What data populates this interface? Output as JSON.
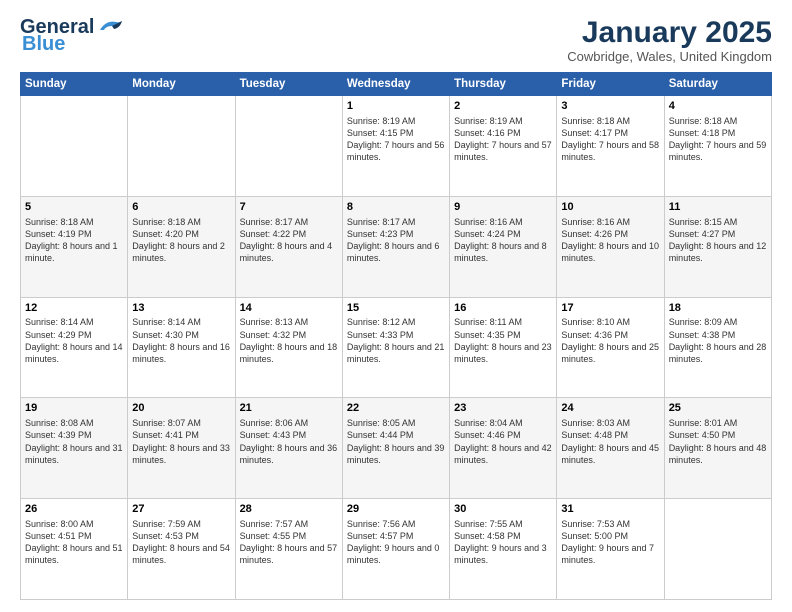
{
  "app": {
    "logo_line1": "General",
    "logo_line2": "Blue"
  },
  "header": {
    "month": "January 2025",
    "location": "Cowbridge, Wales, United Kingdom"
  },
  "weekdays": [
    "Sunday",
    "Monday",
    "Tuesday",
    "Wednesday",
    "Thursday",
    "Friday",
    "Saturday"
  ],
  "weeks": [
    [
      {
        "day": "",
        "sunrise": "",
        "sunset": "",
        "daylight": ""
      },
      {
        "day": "",
        "sunrise": "",
        "sunset": "",
        "daylight": ""
      },
      {
        "day": "",
        "sunrise": "",
        "sunset": "",
        "daylight": ""
      },
      {
        "day": "1",
        "sunrise": "Sunrise: 8:19 AM",
        "sunset": "Sunset: 4:15 PM",
        "daylight": "Daylight: 7 hours and 56 minutes."
      },
      {
        "day": "2",
        "sunrise": "Sunrise: 8:19 AM",
        "sunset": "Sunset: 4:16 PM",
        "daylight": "Daylight: 7 hours and 57 minutes."
      },
      {
        "day": "3",
        "sunrise": "Sunrise: 8:18 AM",
        "sunset": "Sunset: 4:17 PM",
        "daylight": "Daylight: 7 hours and 58 minutes."
      },
      {
        "day": "4",
        "sunrise": "Sunrise: 8:18 AM",
        "sunset": "Sunset: 4:18 PM",
        "daylight": "Daylight: 7 hours and 59 minutes."
      }
    ],
    [
      {
        "day": "5",
        "sunrise": "Sunrise: 8:18 AM",
        "sunset": "Sunset: 4:19 PM",
        "daylight": "Daylight: 8 hours and 1 minute."
      },
      {
        "day": "6",
        "sunrise": "Sunrise: 8:18 AM",
        "sunset": "Sunset: 4:20 PM",
        "daylight": "Daylight: 8 hours and 2 minutes."
      },
      {
        "day": "7",
        "sunrise": "Sunrise: 8:17 AM",
        "sunset": "Sunset: 4:22 PM",
        "daylight": "Daylight: 8 hours and 4 minutes."
      },
      {
        "day": "8",
        "sunrise": "Sunrise: 8:17 AM",
        "sunset": "Sunset: 4:23 PM",
        "daylight": "Daylight: 8 hours and 6 minutes."
      },
      {
        "day": "9",
        "sunrise": "Sunrise: 8:16 AM",
        "sunset": "Sunset: 4:24 PM",
        "daylight": "Daylight: 8 hours and 8 minutes."
      },
      {
        "day": "10",
        "sunrise": "Sunrise: 8:16 AM",
        "sunset": "Sunset: 4:26 PM",
        "daylight": "Daylight: 8 hours and 10 minutes."
      },
      {
        "day": "11",
        "sunrise": "Sunrise: 8:15 AM",
        "sunset": "Sunset: 4:27 PM",
        "daylight": "Daylight: 8 hours and 12 minutes."
      }
    ],
    [
      {
        "day": "12",
        "sunrise": "Sunrise: 8:14 AM",
        "sunset": "Sunset: 4:29 PM",
        "daylight": "Daylight: 8 hours and 14 minutes."
      },
      {
        "day": "13",
        "sunrise": "Sunrise: 8:14 AM",
        "sunset": "Sunset: 4:30 PM",
        "daylight": "Daylight: 8 hours and 16 minutes."
      },
      {
        "day": "14",
        "sunrise": "Sunrise: 8:13 AM",
        "sunset": "Sunset: 4:32 PM",
        "daylight": "Daylight: 8 hours and 18 minutes."
      },
      {
        "day": "15",
        "sunrise": "Sunrise: 8:12 AM",
        "sunset": "Sunset: 4:33 PM",
        "daylight": "Daylight: 8 hours and 21 minutes."
      },
      {
        "day": "16",
        "sunrise": "Sunrise: 8:11 AM",
        "sunset": "Sunset: 4:35 PM",
        "daylight": "Daylight: 8 hours and 23 minutes."
      },
      {
        "day": "17",
        "sunrise": "Sunrise: 8:10 AM",
        "sunset": "Sunset: 4:36 PM",
        "daylight": "Daylight: 8 hours and 25 minutes."
      },
      {
        "day": "18",
        "sunrise": "Sunrise: 8:09 AM",
        "sunset": "Sunset: 4:38 PM",
        "daylight": "Daylight: 8 hours and 28 minutes."
      }
    ],
    [
      {
        "day": "19",
        "sunrise": "Sunrise: 8:08 AM",
        "sunset": "Sunset: 4:39 PM",
        "daylight": "Daylight: 8 hours and 31 minutes."
      },
      {
        "day": "20",
        "sunrise": "Sunrise: 8:07 AM",
        "sunset": "Sunset: 4:41 PM",
        "daylight": "Daylight: 8 hours and 33 minutes."
      },
      {
        "day": "21",
        "sunrise": "Sunrise: 8:06 AM",
        "sunset": "Sunset: 4:43 PM",
        "daylight": "Daylight: 8 hours and 36 minutes."
      },
      {
        "day": "22",
        "sunrise": "Sunrise: 8:05 AM",
        "sunset": "Sunset: 4:44 PM",
        "daylight": "Daylight: 8 hours and 39 minutes."
      },
      {
        "day": "23",
        "sunrise": "Sunrise: 8:04 AM",
        "sunset": "Sunset: 4:46 PM",
        "daylight": "Daylight: 8 hours and 42 minutes."
      },
      {
        "day": "24",
        "sunrise": "Sunrise: 8:03 AM",
        "sunset": "Sunset: 4:48 PM",
        "daylight": "Daylight: 8 hours and 45 minutes."
      },
      {
        "day": "25",
        "sunrise": "Sunrise: 8:01 AM",
        "sunset": "Sunset: 4:50 PM",
        "daylight": "Daylight: 8 hours and 48 minutes."
      }
    ],
    [
      {
        "day": "26",
        "sunrise": "Sunrise: 8:00 AM",
        "sunset": "Sunset: 4:51 PM",
        "daylight": "Daylight: 8 hours and 51 minutes."
      },
      {
        "day": "27",
        "sunrise": "Sunrise: 7:59 AM",
        "sunset": "Sunset: 4:53 PM",
        "daylight": "Daylight: 8 hours and 54 minutes."
      },
      {
        "day": "28",
        "sunrise": "Sunrise: 7:57 AM",
        "sunset": "Sunset: 4:55 PM",
        "daylight": "Daylight: 8 hours and 57 minutes."
      },
      {
        "day": "29",
        "sunrise": "Sunrise: 7:56 AM",
        "sunset": "Sunset: 4:57 PM",
        "daylight": "Daylight: 9 hours and 0 minutes."
      },
      {
        "day": "30",
        "sunrise": "Sunrise: 7:55 AM",
        "sunset": "Sunset: 4:58 PM",
        "daylight": "Daylight: 9 hours and 3 minutes."
      },
      {
        "day": "31",
        "sunrise": "Sunrise: 7:53 AM",
        "sunset": "Sunset: 5:00 PM",
        "daylight": "Daylight: 9 hours and 7 minutes."
      },
      {
        "day": "",
        "sunrise": "",
        "sunset": "",
        "daylight": ""
      }
    ]
  ]
}
